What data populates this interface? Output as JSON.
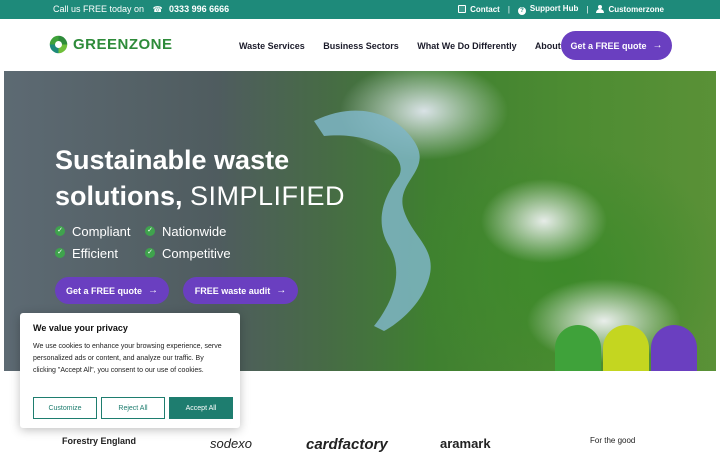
{
  "topbar": {
    "call_text": "Call us FREE today on",
    "phone": "0333 996 6666",
    "links": [
      {
        "label": "Contact",
        "icon": "envelope-icon"
      },
      {
        "label": "Support Hub",
        "icon": "help-icon"
      },
      {
        "label": "Customerzone",
        "icon": "user-icon"
      }
    ]
  },
  "brand": {
    "name": "GREENZONE"
  },
  "nav": {
    "items": [
      "Waste Services",
      "Business Sectors",
      "What We Do Differently",
      "About Us"
    ],
    "cta": "Get a FREE quote"
  },
  "hero": {
    "headline_line1": "Sustainable waste",
    "headline_line2_bold": "solutions,",
    "headline_line2_thin": "SIMPLIFIED",
    "features": [
      "Compliant",
      "Nationwide",
      "Efficient",
      "Competitive"
    ],
    "cta_primary": "Get a FREE quote",
    "cta_secondary": "FREE waste audit"
  },
  "cookie": {
    "title": "We value your privacy",
    "text": "We use cookies to enhance your browsing experience, serve personalized ads or content, and analyze our traffic. By clicking \"Accept All\", you consent to our use of cookies.",
    "customize": "Customize",
    "reject": "Reject All",
    "accept": "Accept All"
  },
  "client_logos": [
    "Forestry England",
    "sodexo",
    "cardfactory",
    "aramark",
    "For the good"
  ],
  "colors": {
    "teal": "#1e8a7a",
    "purple": "#6a3fc0",
    "green": "#2e8b3a",
    "blob_green": "#3fa23a",
    "blob_lime": "#c4d620",
    "blob_purple": "#6a3fc0"
  }
}
